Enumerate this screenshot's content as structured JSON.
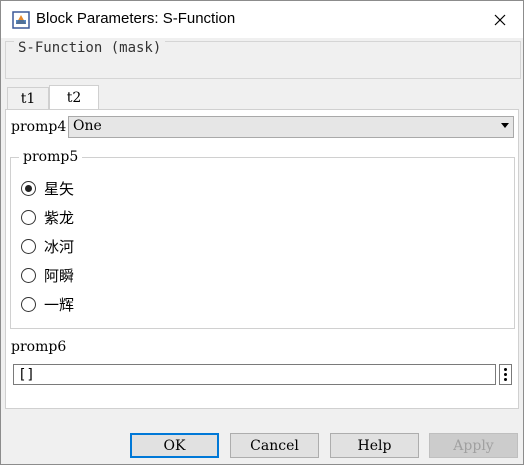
{
  "window": {
    "title": "Block Parameters: S-Function"
  },
  "mask": {
    "label": "S-Function (mask)"
  },
  "tabs": [
    {
      "label": "t1",
      "active": false
    },
    {
      "label": "t2",
      "active": true
    }
  ],
  "promp4": {
    "label": "promp4",
    "value": "One"
  },
  "promp5": {
    "label": "promp5",
    "options": [
      "星矢",
      "紫龙",
      "冰河",
      "阿瞬",
      "一辉"
    ],
    "selected": "星矢"
  },
  "promp6": {
    "label": "promp6",
    "value": "[]"
  },
  "buttons": {
    "ok": "OK",
    "cancel": "Cancel",
    "help": "Help",
    "apply": "Apply"
  },
  "colors": {
    "focus_border": "#0078d7",
    "disabled_text": "#a0a0a0"
  },
  "icons": {
    "app": "simulink-block-icon",
    "close": "close-icon",
    "dropdown": "chevron-down-icon",
    "more": "more-vertical-icon"
  }
}
